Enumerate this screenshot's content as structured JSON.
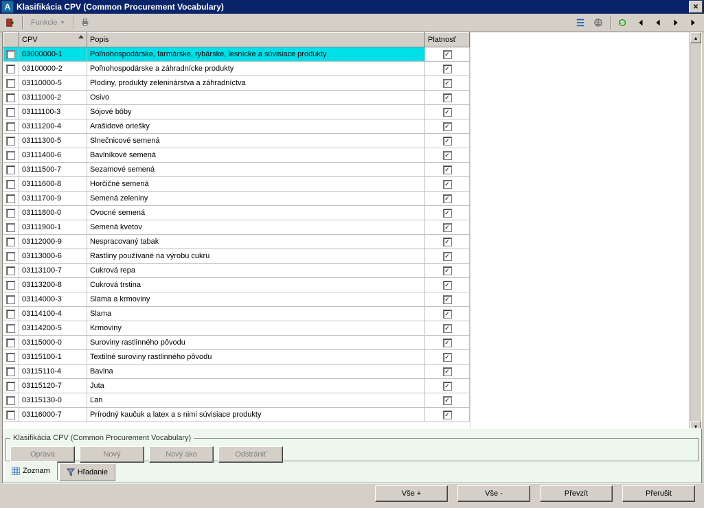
{
  "window": {
    "title": "Klasifikácia CPV (Common Procurement Vocabulary)",
    "app_icon_letter": "A"
  },
  "toolbar": {
    "funkcie_label": "Funkcie"
  },
  "grid": {
    "columns": {
      "cpv": "CPV",
      "popis": "Popis",
      "platnost": "Platnosť"
    },
    "rows": [
      {
        "sel": false,
        "cpv": "03000000-1",
        "popis": "Poľnohospodárske, farmárske, rybárske, lesnícke a súvisiace produkty",
        "platnost": true,
        "highlighted": true
      },
      {
        "sel": false,
        "cpv": "03100000-2",
        "popis": "Poľnohospodárske a záhradnícke produkty",
        "platnost": true
      },
      {
        "sel": false,
        "cpv": "03110000-5",
        "popis": "Plodiny, produkty zeleninárstva a záhradníctva",
        "platnost": true
      },
      {
        "sel": false,
        "cpv": "03111000-2",
        "popis": "Osivo",
        "platnost": true
      },
      {
        "sel": false,
        "cpv": "03111100-3",
        "popis": "Sójové bôby",
        "platnost": true
      },
      {
        "sel": false,
        "cpv": "03111200-4",
        "popis": "Arašidové oriešky",
        "platnost": true
      },
      {
        "sel": false,
        "cpv": "03111300-5",
        "popis": "Slnečnicové semená",
        "platnost": true
      },
      {
        "sel": false,
        "cpv": "03111400-6",
        "popis": "Bavlníkové semená",
        "platnost": true
      },
      {
        "sel": false,
        "cpv": "03111500-7",
        "popis": "Sezamové semená",
        "platnost": true
      },
      {
        "sel": false,
        "cpv": "03111600-8",
        "popis": "Horčičné semená",
        "platnost": true
      },
      {
        "sel": false,
        "cpv": "03111700-9",
        "popis": "Semená zeleniny",
        "platnost": true
      },
      {
        "sel": false,
        "cpv": "03111800-0",
        "popis": "Ovocné semená",
        "platnost": true
      },
      {
        "sel": false,
        "cpv": "03111900-1",
        "popis": "Semená kvetov",
        "platnost": true
      },
      {
        "sel": false,
        "cpv": "03112000-9",
        "popis": "Nespracovaný tabak",
        "platnost": true
      },
      {
        "sel": false,
        "cpv": "03113000-6",
        "popis": "Rastliny používané na výrobu cukru",
        "platnost": true
      },
      {
        "sel": false,
        "cpv": "03113100-7",
        "popis": "Cukrová repa",
        "platnost": true
      },
      {
        "sel": false,
        "cpv": "03113200-8",
        "popis": "Cukrová trstina",
        "platnost": true
      },
      {
        "sel": false,
        "cpv": "03114000-3",
        "popis": "Slama a krmoviny",
        "platnost": true
      },
      {
        "sel": false,
        "cpv": "03114100-4",
        "popis": "Slama",
        "platnost": true
      },
      {
        "sel": false,
        "cpv": "03114200-5",
        "popis": "Krmoviny",
        "platnost": true
      },
      {
        "sel": false,
        "cpv": "03115000-0",
        "popis": "Suroviny rastlinného pôvodu",
        "platnost": true
      },
      {
        "sel": false,
        "cpv": "03115100-1",
        "popis": "Textilné suroviny rastlinného pôvodu",
        "platnost": true
      },
      {
        "sel": false,
        "cpv": "03115110-4",
        "popis": "Bavlna",
        "platnost": true
      },
      {
        "sel": false,
        "cpv": "03115120-7",
        "popis": "Juta",
        "platnost": true
      },
      {
        "sel": false,
        "cpv": "03115130-0",
        "popis": "Ľan",
        "platnost": true
      },
      {
        "sel": false,
        "cpv": "03116000-7",
        "popis": "Prírodný kaučuk a latex a s nimi súvisiace produkty",
        "platnost": true
      }
    ]
  },
  "groupbox": {
    "legend": "Klasifikácia CPV (Common Procurement Vocabulary)",
    "buttons": {
      "oprava": "Oprava",
      "novy": "Nový",
      "novy_ako": "Nový ako",
      "odstranit": "Odstrániť"
    }
  },
  "tabs": {
    "zoznam": "Zoznam",
    "hladanie": "Hľadanie"
  },
  "footer": {
    "vse_plus": "Vše +",
    "vse_minus": "Vše -",
    "prevzit": "Převzít",
    "prerusit": "Přerušit"
  }
}
